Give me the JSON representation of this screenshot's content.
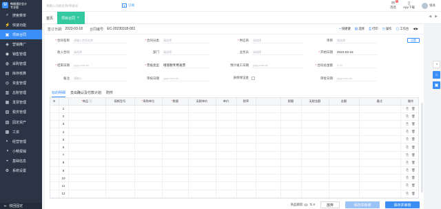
{
  "sidebar": {
    "logo_mark": "U",
    "logo_line1": "畅捷通好会计",
    "logo_line2": "专业版",
    "items": [
      {
        "label": "搜索菜单",
        "icon": "⌕"
      },
      {
        "label": "快速功能",
        "icon": "⚡"
      },
      {
        "label": "项目合同",
        "icon": "▣"
      },
      {
        "label": "营销推广",
        "icon": "◈"
      },
      {
        "label": "销售管理",
        "icon": "◉"
      },
      {
        "label": "采购管理",
        "icon": "◍"
      },
      {
        "label": "库存核算",
        "icon": "▤"
      },
      {
        "label": "资金管理",
        "icon": "◎"
      },
      {
        "label": "总账管理",
        "icon": "▥"
      },
      {
        "label": "发票管理",
        "icon": "▦"
      },
      {
        "label": "税务管理",
        "icon": "▧"
      },
      {
        "label": "固定资产",
        "icon": "▨"
      },
      {
        "label": "工资",
        "icon": "▩"
      },
      {
        "label": "经营管理",
        "icon": "◐"
      },
      {
        "label": "小畅报销",
        "icon": "◑"
      },
      {
        "label": "基础信息",
        "icon": "◒"
      },
      {
        "label": "系统设置",
        "icon": "⚙"
      }
    ],
    "active_index": 2,
    "collapse_label": "收回固定"
  },
  "topbar": {
    "search_placeholder": "请输入功能名称/单据号",
    "filter_label": "订阅",
    "messages_label": "消息",
    "messages_badge": "5",
    "app_label": "App下载",
    "user_label": "张总"
  },
  "tabs": {
    "home": "首页",
    "current": "项目合同",
    "current_close": "×",
    "prev": "◀",
    "next": "▶"
  },
  "meta": {
    "date_label": "签订日期:",
    "date_value": "2023-03-18",
    "code_label": "合同编号:",
    "code_value": "EC-20230318-001"
  },
  "tools": [
    {
      "icon": "⌁",
      "label": "快捷键"
    },
    {
      "icon": "▤",
      "label": "选择"
    },
    {
      "icon": "⎙",
      "label": "打印"
    },
    {
      "icon": "◷",
      "label": "操作"
    },
    {
      "icon": "▢",
      "label": "工作台"
    }
  ],
  "pager": "◀ ▶",
  "form": {
    "set_button": "设置",
    "fields": [
      {
        "req": "*",
        "label": "合同名称",
        "placeholder": "请输入合同名称"
      },
      {
        "req": "*",
        "label": "合同分类",
        "placeholder": "请选择"
      },
      {
        "req": "*",
        "label": "供应商",
        "placeholder": "请选择"
      },
      {
        "req": "",
        "label": "项目",
        "placeholder": "请选择"
      },
      {
        "req": "",
        "label": "收入合同",
        "placeholder": "请选择"
      },
      {
        "req": "",
        "label": "部门",
        "placeholder": "请选择"
      },
      {
        "req": "",
        "label": "业务员",
        "placeholder": "请选择"
      },
      {
        "req": "*",
        "label": "开始日期",
        "value": "2023-03-18"
      },
      {
        "req": "*",
        "label": "结束日期",
        "placeholder": "yyyy-mm-dd"
      },
      {
        "req": "*",
        "label": "票据类型",
        "value": "增值税专用发票"
      },
      {
        "req": "",
        "label": "预计竣工日期",
        "placeholder": "yyyy-mm-dd"
      },
      {
        "req": "*",
        "label": "合同总金额",
        "placeholder": "0.00"
      },
      {
        "req": "",
        "label": "备注",
        "placeholder": "请输入"
      },
      {
        "req": "",
        "label": "审核日期",
        "placeholder": "yyyy-mm-dd"
      },
      {
        "req": "",
        "label": "质保保证金"
      },
      {
        "req": "",
        "label": "审批日期",
        "placeholder": "yyyy-mm-dd"
      }
    ]
  },
  "subtabs": [
    "标的明细",
    "支出确认及付款计划",
    "附件"
  ],
  "grid": {
    "columns": [
      {
        "label": "⚙",
        "req": ""
      },
      {
        "label": "",
        "req": ""
      },
      {
        "label": "商品 ⓘ",
        "req": "*"
      },
      {
        "label": "规格型号",
        "req": ""
      },
      {
        "label": "采购单位",
        "req": "*"
      },
      {
        "label": "数量",
        "req": "*"
      },
      {
        "label": "无税单价",
        "req": ""
      },
      {
        "label": "单价",
        "req": ""
      },
      {
        "label": "税率",
        "req": ""
      },
      {
        "label": "",
        "req": ""
      },
      {
        "label": "税额",
        "req": ""
      },
      {
        "label": "无税金额",
        "req": ""
      },
      {
        "label": "金额",
        "req": ""
      },
      {
        "label": "备注",
        "req": ""
      },
      {
        "label": "操作",
        "req": ""
      }
    ],
    "rows": [
      "1",
      "2",
      "3",
      "4",
      "5",
      "6",
      "7",
      "8",
      "9",
      "10",
      "11",
      "12"
    ],
    "op_icons": [
      "⎘",
      "🗑"
    ]
  },
  "footer": {
    "trace_label": "商品跟踪",
    "trace_hint": "⇅ 8",
    "discard": "放弃",
    "save_add": "保存并新增",
    "save_audit": "保存并审核"
  },
  "rightbar": [
    "◔",
    "⌂",
    "▣"
  ]
}
